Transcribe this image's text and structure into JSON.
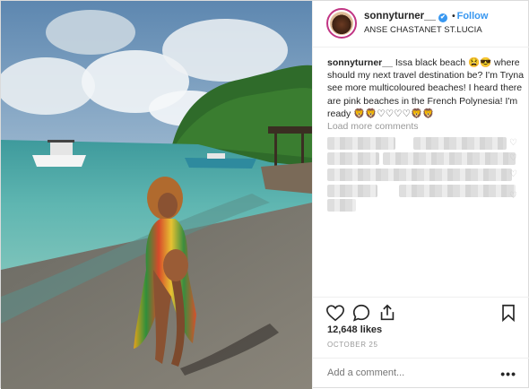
{
  "header": {
    "username": "sonnyturner__",
    "follow_label": "Follow",
    "dot": "•",
    "location": "ANSE CHASTANET ST.LUCIA",
    "verified_icon": "✔"
  },
  "caption": {
    "username": "sonnyturner__",
    "text": " Issa black beach 😫😎 where should my next travel destination be? I'm Tryna see more multicoloured beaches! I heard there are pink beaches in the French Polynesia! I'm ready 🦁🦁♡♡♡♡🦁🦁"
  },
  "comments": {
    "load_more_label": "Load more comments"
  },
  "stats": {
    "likes": "12,648 likes",
    "date": "OCTOBER 25"
  },
  "add_comment": {
    "placeholder": "Add a comment..."
  },
  "more_label": "•••",
  "icons": {
    "like": "heart-icon",
    "comment": "comment-icon",
    "share": "share-icon",
    "save": "bookmark-icon",
    "comment_like": "small-heart-icon"
  }
}
